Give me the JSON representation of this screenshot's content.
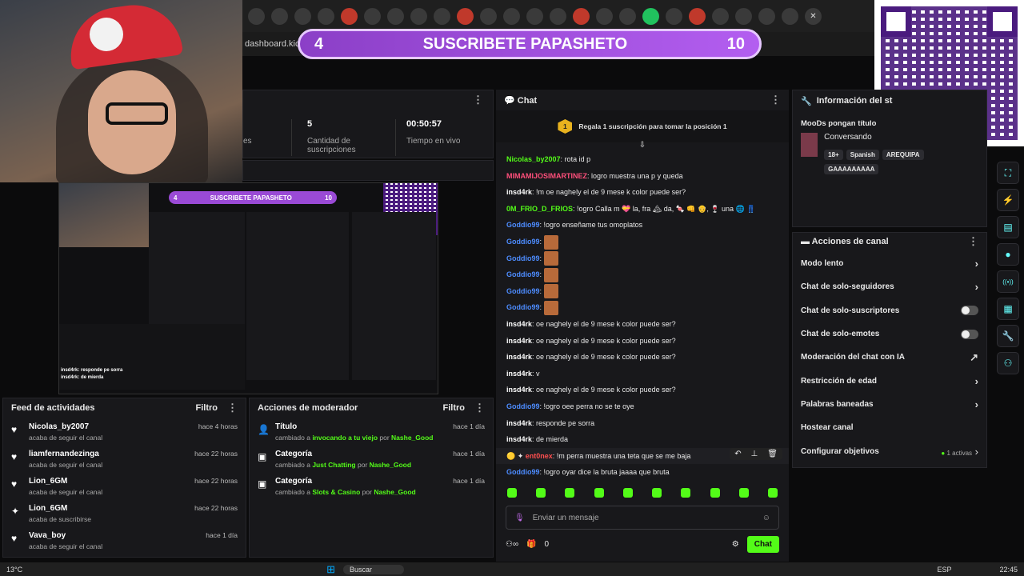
{
  "browser": {
    "url": "dashboard.kick.",
    "tab_icons": [
      "tab-icon",
      "tab-icon",
      "tab-icon",
      "tab-icon",
      "tab-icon",
      "tab-icon",
      "tab-icon",
      "tab-icon",
      "tab-icon",
      "tab-icon",
      "tab-icon",
      "tab-icon",
      "tab-icon",
      "tab-icon",
      "tab-icon",
      "tab-icon",
      "tab-icon",
      "tab-icon",
      "tab-icon",
      "tab-icon",
      "tab-icon",
      "tab-icon",
      "tab-icon",
      "tab-icon"
    ],
    "close_label": "✕"
  },
  "banner": {
    "left": "4",
    "text": "SUSCRIBETE PAPASHETO",
    "right": "10"
  },
  "stats": [
    {
      "value": "5",
      "label": "Cantidad de suscripciones"
    },
    {
      "value": "00:50:57",
      "label": "Tiempo en vivo"
    }
  ],
  "stats_partial": "es",
  "mini": {
    "left": "4",
    "text": "SUSCRIBETE PAPASHETO",
    "right": "10",
    "overlay1": "insd4rk: responde pe sorra",
    "overlay2": "insd4rk: de mierda"
  },
  "chat": {
    "title": "Chat",
    "promo_badge": "1",
    "promo_text": "Regala 1 suscripción para tomar la posición 1",
    "messages": [
      {
        "user": "Nicolas_by2007",
        "color": "#53fc18",
        "text": "rota id p"
      },
      {
        "user": "MIMAMIJOSIMARTINEZ",
        "color": "#ff4f7b",
        "text": "logro muestra una p y queda"
      },
      {
        "user": "insd4rk",
        "color": "#ffffff",
        "text": "!m oe naghely el de 9 mese k color puede ser?"
      },
      {
        "user": "0M_FRIO_D_FRIOS",
        "color": "#53fc18",
        "text": "!ogro Calla m 💝 la, fra 🏔 da, 🍬 👊 👴, 🍷 una 🌐 👖"
      },
      {
        "user": "Goddio99",
        "color": "#4d8cff",
        "text": "!ogro enseñame tus omoplatos"
      },
      {
        "user": "Goddio99",
        "color": "#4d8cff",
        "text": ""
      },
      {
        "user": "Goddio99",
        "color": "#4d8cff",
        "text": ""
      },
      {
        "user": "Goddio99",
        "color": "#4d8cff",
        "text": ""
      },
      {
        "user": "Goddio99",
        "color": "#4d8cff",
        "text": ""
      },
      {
        "user": "Goddio99",
        "color": "#4d8cff",
        "text": ""
      },
      {
        "user": "insd4rk",
        "color": "#ffffff",
        "text": "oe naghely el de 9 mese k color puede ser?"
      },
      {
        "user": "insd4rk",
        "color": "#ffffff",
        "text": "oe naghely el de 9 mese k color puede ser?"
      },
      {
        "user": "insd4rk",
        "color": "#ffffff",
        "text": "oe naghely el de 9 mese k color puede ser?"
      },
      {
        "user": "insd4rk",
        "color": "#ffffff",
        "text": "v"
      },
      {
        "user": "insd4rk",
        "color": "#ffffff",
        "text": "oe naghely el de 9 mese k color puede ser?"
      },
      {
        "user": "Goddio99",
        "color": "#4d8cff",
        "text": "!ogro oee perra no se te oye"
      },
      {
        "user": "insd4rk",
        "color": "#ffffff",
        "text": "responde pe sorra"
      },
      {
        "user": "insd4rk",
        "color": "#ffffff",
        "text": "de mierda"
      },
      {
        "user": "ent0nex",
        "color": "#ff4f4f",
        "text": "!m perra muestra una teta que se me baja"
      },
      {
        "user": "Goddio99",
        "color": "#4d8cff",
        "text": "!ogro oyar dice la bruta jaaaa que bruta"
      }
    ],
    "input_placeholder": "Enviar un mensaje",
    "viewer_count": "0",
    "send_label": "Chat"
  },
  "feed": {
    "title": "Feed de actividades",
    "filter": "Filtro",
    "items": [
      {
        "icon": "heart-icon",
        "name": "Nicolas_by2007",
        "sub": "acaba de seguir el canal",
        "time": "hace 4 horas"
      },
      {
        "icon": "heart-icon",
        "name": "liamfernandezinga",
        "sub": "acaba de seguir el canal",
        "time": "hace 22 horas"
      },
      {
        "icon": "heart-icon",
        "name": "Lion_6GM",
        "sub": "acaba de seguir el canal",
        "time": "hace 22 horas"
      },
      {
        "icon": "sparkle-icon",
        "name": "Lion_6GM",
        "sub": "acaba de suscribirse",
        "time": "hace 22 horas"
      },
      {
        "icon": "heart-icon",
        "name": "Vava_boy",
        "sub": "acaba de seguir el canal",
        "time": "hace 1 día"
      }
    ]
  },
  "mods": {
    "title": "Acciones de moderador",
    "filter": "Filtro",
    "items": [
      {
        "icon": "user-icon",
        "title": "Título",
        "pre": "cambiado a ",
        "value": "invocando a tu viejo",
        "by": " por ",
        "mod": "Nashe_Good",
        "time": "hace 1 día"
      },
      {
        "icon": "category-icon",
        "title": "Categoría",
        "pre": "cambiado a ",
        "value": "Just Chatting",
        "by": " por ",
        "mod": "Nashe_Good",
        "time": "hace 1 día"
      },
      {
        "icon": "category-icon",
        "title": "Categoría",
        "pre": "cambiado a ",
        "value": "Slots & Casino",
        "by": " por ",
        "mod": "Nashe_Good",
        "time": "hace 1 día"
      }
    ]
  },
  "info": {
    "title": "Información del st",
    "stream_title": "MooDs pongan título",
    "category": "Conversando",
    "tags": [
      "18+",
      "Spanish",
      "AREQUIPA",
      "GAAAAAAAAA"
    ]
  },
  "canal": {
    "title": "Acciones de canal",
    "rows": [
      {
        "label": "Modo lento",
        "control": "chevron"
      },
      {
        "label": "Chat de solo-seguidores",
        "control": "chevron"
      },
      {
        "label": "Chat de solo-suscriptores",
        "control": "toggle"
      },
      {
        "label": "Chat de solo-emotes",
        "control": "toggle"
      },
      {
        "label": "Moderación del chat con IA",
        "control": "external"
      },
      {
        "label": "Restricción de edad",
        "control": "chevron"
      },
      {
        "label": "Palabras baneadas",
        "control": "chevron"
      },
      {
        "label": "Hostear canal",
        "control": "none"
      },
      {
        "label": "Configurar objetivos",
        "control": "goals"
      }
    ],
    "goals_text": "1 activas"
  },
  "rail_icons": [
    "expand-icon",
    "bolt-icon",
    "document-icon",
    "chat-bubble-icon",
    "broadcast-icon",
    "layout-icon",
    "wrench-icon",
    "users-icon"
  ],
  "taskbar": {
    "temp": "13°C",
    "search": "Buscar",
    "lang": "ESP",
    "time": "22:45"
  },
  "colors": {
    "accent": "#53fc18",
    "banner": "#9a4ad6",
    "panel": "#18181b"
  }
}
